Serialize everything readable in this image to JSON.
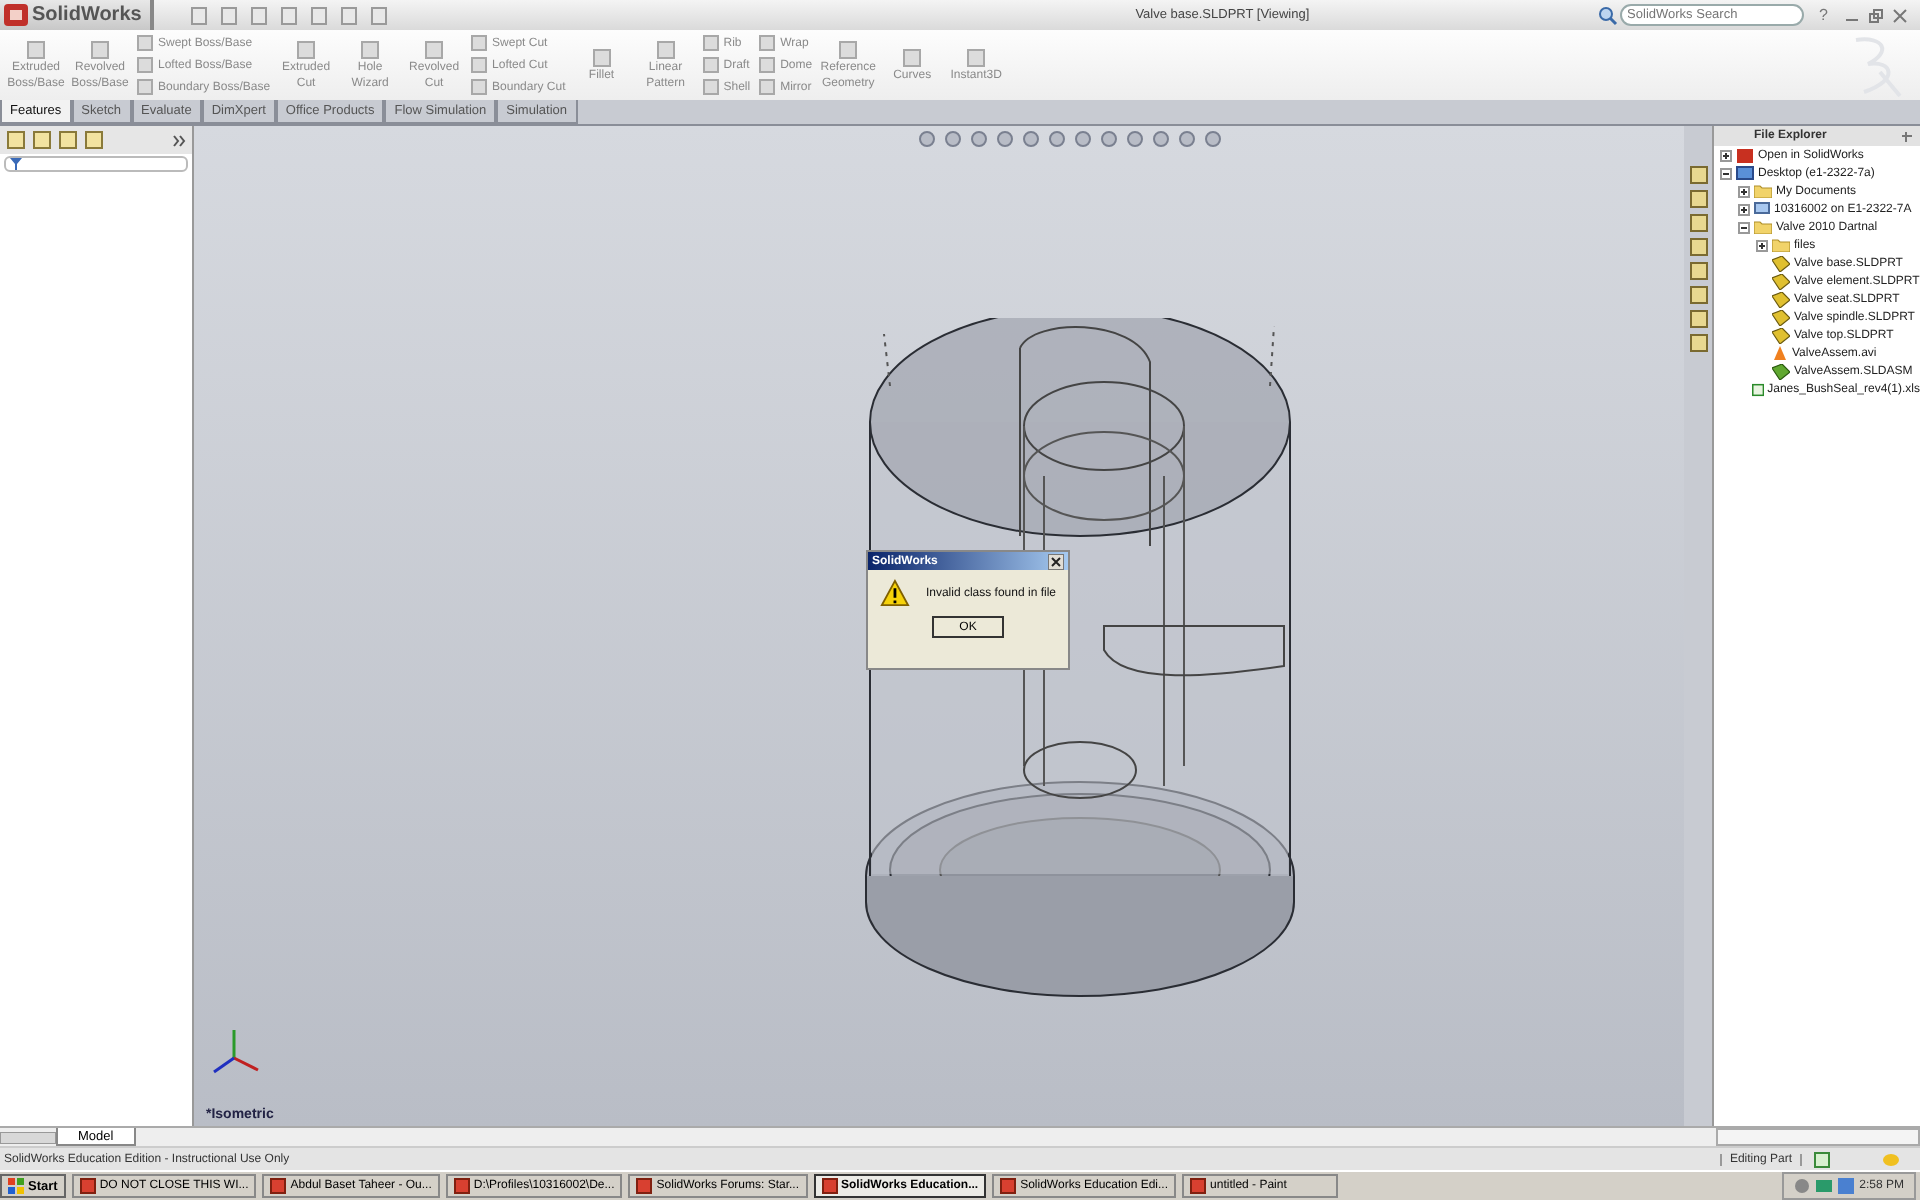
{
  "app_title": "SolidWorks",
  "window_title": "Valve base.SLDPRT [Viewing]",
  "search": {
    "placeholder": "SolidWorks Search"
  },
  "help_label": "?",
  "ribbon": [
    {
      "kind": "large",
      "label": "Extruded Boss/Base"
    },
    {
      "kind": "large",
      "label": "Revolved Boss/Base"
    },
    {
      "kind": "stack",
      "items": [
        "Swept Boss/Base",
        "Lofted Boss/Base",
        "Boundary Boss/Base"
      ]
    },
    {
      "kind": "large",
      "label": "Extruded Cut"
    },
    {
      "kind": "large",
      "label": "Hole Wizard"
    },
    {
      "kind": "large",
      "label": "Revolved Cut"
    },
    {
      "kind": "stack",
      "items": [
        "Swept Cut",
        "Lofted Cut",
        "Boundary Cut"
      ]
    },
    {
      "kind": "large",
      "label": "Fillet"
    },
    {
      "kind": "large",
      "label": "Linear Pattern"
    },
    {
      "kind": "stack",
      "items": [
        "Rib",
        "Draft",
        "Shell"
      ]
    },
    {
      "kind": "stack",
      "items": [
        "Wrap",
        "Dome",
        "Mirror"
      ]
    },
    {
      "kind": "large",
      "label": "Reference Geometry"
    },
    {
      "kind": "large",
      "label": "Curves"
    },
    {
      "kind": "large",
      "label": "Instant3D"
    }
  ],
  "tabs": [
    {
      "label": "Features",
      "selected": true
    },
    {
      "label": "Sketch",
      "selected": false
    },
    {
      "label": "Evaluate",
      "selected": false
    },
    {
      "label": "DimXpert",
      "selected": false
    },
    {
      "label": "Office Products",
      "selected": false
    },
    {
      "label": "Flow Simulation",
      "selected": false
    },
    {
      "label": "Simulation",
      "selected": false
    }
  ],
  "file_explorer": {
    "title": "File Explorer",
    "tree": [
      {
        "label": "Open in SolidWorks",
        "kind": "app",
        "expanded": false
      },
      {
        "label": "Desktop (e1-2322-7a)",
        "kind": "desktop",
        "expanded": true,
        "children": [
          {
            "label": "My Documents",
            "kind": "folder",
            "expanded": false
          },
          {
            "label": "10316002 on E1-2322-7A",
            "kind": "computer",
            "expanded": false
          },
          {
            "label": "Valve 2010 Dartnal",
            "kind": "folder",
            "expanded": true,
            "children": [
              {
                "label": "files",
                "kind": "folder",
                "expanded": false
              },
              {
                "label": "Valve base.SLDPRT",
                "kind": "part"
              },
              {
                "label": "Valve element.SLDPRT",
                "kind": "part"
              },
              {
                "label": "Valve seat.SLDPRT",
                "kind": "part"
              },
              {
                "label": "Valve spindle.SLDPRT",
                "kind": "part"
              },
              {
                "label": "Valve top.SLDPRT",
                "kind": "part"
              },
              {
                "label": "ValveAssem.avi",
                "kind": "video"
              },
              {
                "label": "ValveAssem.SLDASM",
                "kind": "assembly"
              }
            ]
          },
          {
            "label": "Janes_BushSeal_rev4(1).xls",
            "kind": "sheet"
          }
        ]
      }
    ]
  },
  "dialog": {
    "title": "SolidWorks",
    "message": "Invalid class found in file",
    "button": "OK"
  },
  "view_label": "*Isometric",
  "bottom_tab": "Model",
  "status_bar": {
    "text": "SolidWorks Education Edition - Instructional Use Only",
    "mode": "Editing Part"
  },
  "taskbar": {
    "start": "Start",
    "tasks": [
      {
        "label": "DO NOT CLOSE THIS WI...",
        "selected": false
      },
      {
        "label": "Abdul Baset Taheer - Ou...",
        "selected": false
      },
      {
        "label": "D:\\Profiles\\10316002\\De...",
        "selected": false
      },
      {
        "label": "SolidWorks Forums: Star...",
        "selected": false
      },
      {
        "label": "SolidWorks Education...",
        "selected": true
      },
      {
        "label": "SolidWorks Education Edi...",
        "selected": false
      },
      {
        "label": "untitled - Paint",
        "selected": false
      }
    ],
    "clock": "2:58 PM"
  }
}
